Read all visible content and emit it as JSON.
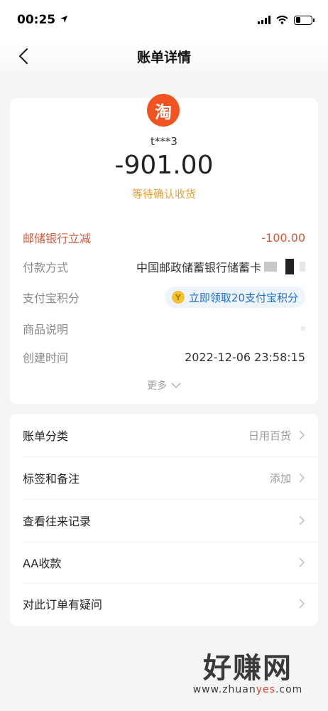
{
  "status_bar": {
    "time": "00:25"
  },
  "nav": {
    "title": "账单详情"
  },
  "summary": {
    "logo_char": "淘",
    "merchant": "t***3",
    "amount": "-901.00",
    "status": "等待确认收货"
  },
  "details": {
    "discount": {
      "label": "邮储银行立减",
      "value": "-100.00"
    },
    "payment_method": {
      "label": "付款方式",
      "value": "中国邮政储蓄银行储蓄卡"
    },
    "points": {
      "label": "支付宝积分",
      "chip_label": "立即领取20支付宝积分",
      "coin_char": "Y"
    },
    "product_desc": {
      "label": "商品说明"
    },
    "created_time": {
      "label": "创建时间",
      "value": "2022-12-06 23:58:15"
    },
    "more_label": "更多"
  },
  "menu": [
    {
      "label": "账单分类",
      "value": "日用百货"
    },
    {
      "label": "标签和备注",
      "value": "添加"
    },
    {
      "label": "查看往来记录",
      "value": ""
    },
    {
      "label": "AA收款",
      "value": ""
    },
    {
      "label": "对此订单有疑问",
      "value": ""
    }
  ],
  "watermark": {
    "title": "好赚网",
    "url_prefix": "www.zhuan",
    "url_highlight": "yes",
    "url_suffix": ".com"
  },
  "colors": {
    "accent_orange": "#e6a13a",
    "discount_red": "#d45a3a",
    "link_blue": "#1c6fd6",
    "taobao_orange": "#f2531f"
  },
  "icons": [
    "location-arrow-icon",
    "signal-icon",
    "wifi-icon",
    "battery-icon",
    "back-chevron-icon",
    "taobao-logo-icon",
    "coin-icon",
    "chevron-down-icon",
    "chevron-right-icon"
  ]
}
